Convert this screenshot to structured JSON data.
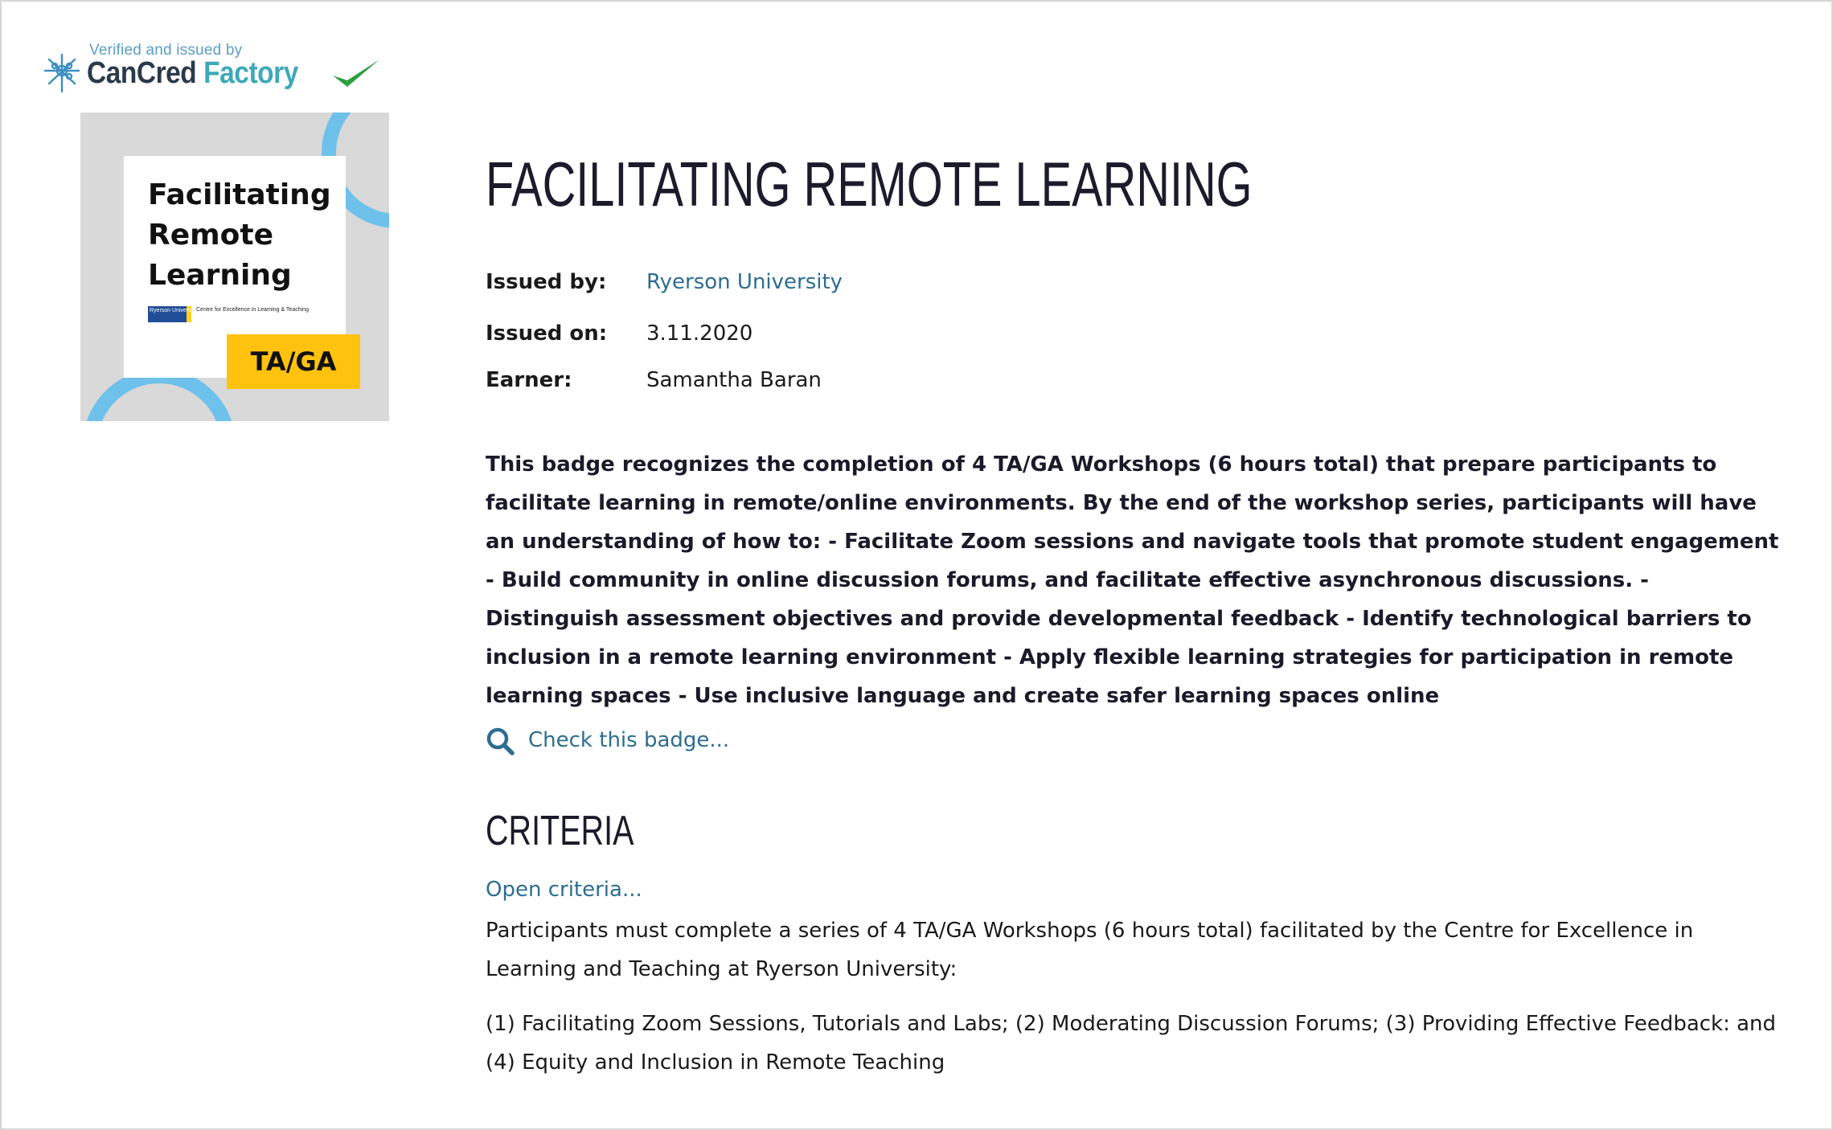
{
  "verification": {
    "small_text": "Verified and issued by",
    "brand_part1": "CanCred",
    "brand_part2": "Factory"
  },
  "badge_image": {
    "title_line1": "Facilitating",
    "title_line2": "Remote",
    "title_line3": "Learning",
    "logo_left": "Ryerson University",
    "logo_right": "Centre for Excellence in Learning & Teaching",
    "tag": "TA/GA"
  },
  "title": "FACILITATING REMOTE LEARNING",
  "meta": {
    "issued_by_label": "Issued by:",
    "issued_by_value": "Ryerson University",
    "issued_on_label": "Issued on:",
    "issued_on_value": "3.11.2020",
    "earner_label": "Earner:",
    "earner_value": "Samantha Baran"
  },
  "description": "This badge recognizes the completion of 4 TA/GA Workshops (6 hours total) that prepare participants to facilitate learning in remote/online environments. By the end of the workshop series, participants will have an understanding of how to: - Facilitate Zoom sessions and navigate tools that promote student engagement - Build community in online discussion forums, and facilitate effective asynchronous discussions. - Distinguish assessment objectives and provide developmental feedback - Identify technological barriers to inclusion in a remote learning environment - Apply flexible learning strategies for participation in remote learning spaces - Use inclusive language and create safer learning spaces online",
  "check_badge": "Check this badge...",
  "criteria": {
    "heading": "CRITERIA",
    "open_link": "Open criteria...",
    "paragraph1": "Participants must complete a series of 4 TA/GA Workshops (6 hours total) facilitated by the Centre for Excellence in Learning and Teaching at Ryerson University:",
    "paragraph2": "(1) Facilitating Zoom Sessions, Tutorials and Labs; (2) Moderating Discussion Forums; (3) Providing Effective Feedback: and (4) Equity and Inclusion in Remote Teaching"
  },
  "colors": {
    "link": "#2d6d91",
    "badge_ring": "#6ec1ea",
    "badge_tag": "#ffc20e",
    "check_green": "#2e9e3e"
  },
  "icons": {
    "verify": "maple-leaf-icon",
    "verified": "checkmark-icon",
    "check_badge": "search-icon"
  }
}
